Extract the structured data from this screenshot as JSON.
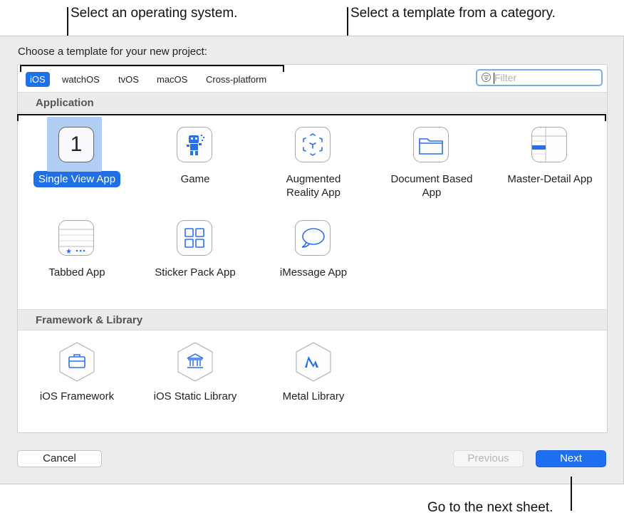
{
  "annotations": {
    "os_callout": "Select an operating system.",
    "template_callout": "Select a template from a category.",
    "next_callout": "Go to the next sheet."
  },
  "dialog": {
    "prompt": "Choose a template for your new project:",
    "platform_tabs": [
      {
        "label": "iOS",
        "selected": true
      },
      {
        "label": "watchOS",
        "selected": false
      },
      {
        "label": "tvOS",
        "selected": false
      },
      {
        "label": "macOS",
        "selected": false
      },
      {
        "label": "Cross-platform",
        "selected": false
      }
    ],
    "filter": {
      "placeholder": "Filter",
      "value": "",
      "icon": "filter-icon"
    },
    "sections": [
      {
        "title": "Application",
        "templates": [
          {
            "label": "Single View App",
            "icon": "single-view-app-icon",
            "selected": true
          },
          {
            "label": "Game",
            "icon": "game-icon",
            "selected": false
          },
          {
            "label": "Augmented\nReality App",
            "icon": "augmented-reality-icon",
            "selected": false
          },
          {
            "label": "Document Based\nApp",
            "icon": "document-based-app-icon",
            "selected": false
          },
          {
            "label": "Master-Detail App",
            "icon": "master-detail-app-icon",
            "selected": false
          },
          {
            "label": "Tabbed App",
            "icon": "tabbed-app-icon",
            "selected": false
          },
          {
            "label": "Sticker Pack App",
            "icon": "sticker-pack-icon",
            "selected": false
          },
          {
            "label": "iMessage App",
            "icon": "imessage-app-icon",
            "selected": false
          }
        ]
      },
      {
        "title": "Framework & Library",
        "templates": [
          {
            "label": "iOS Framework",
            "icon": "framework-icon",
            "selected": false
          },
          {
            "label": "iOS Static Library",
            "icon": "static-library-icon",
            "selected": false
          },
          {
            "label": "Metal Library",
            "icon": "metal-library-icon",
            "selected": false
          }
        ]
      }
    ],
    "buttons": {
      "cancel": "Cancel",
      "previous": "Previous",
      "next": "Next"
    },
    "colors": {
      "accent": "#1f6fe5",
      "selection_background": "#b2cdf3",
      "icon_blue": "#2a6ef0"
    },
    "single_view_glyph": "1"
  }
}
